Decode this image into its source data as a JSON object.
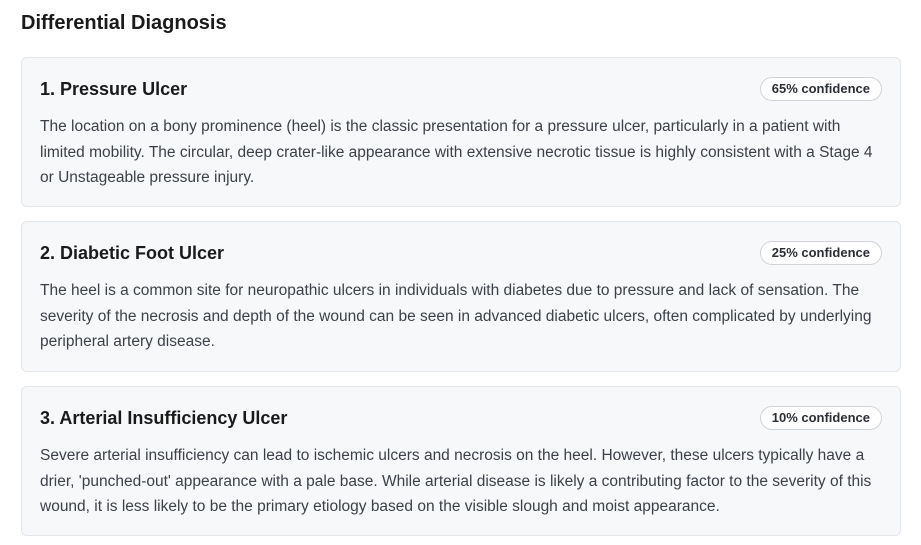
{
  "section": {
    "title": "Differential Diagnosis"
  },
  "diagnoses": [
    {
      "title": "1. Pressure Ulcer",
      "confidence": "65% confidence",
      "description": "The location on a bony prominence (heel) is the classic presentation for a pressure ulcer, particularly in a patient with limited mobility. The circular, deep crater-like appearance with extensive necrotic tissue is highly consistent with a Stage 4 or Unstageable pressure injury."
    },
    {
      "title": "2. Diabetic Foot Ulcer",
      "confidence": "25% confidence",
      "description": "The heel is a common site for neuropathic ulcers in individuals with diabetes due to pressure and lack of sensation. The severity of the necrosis and depth of the wound can be seen in advanced diabetic ulcers, often complicated by underlying peripheral artery disease."
    },
    {
      "title": "3. Arterial Insufficiency Ulcer",
      "confidence": "10% confidence",
      "description": "Severe arterial insufficiency can lead to ischemic ulcers and necrosis on the heel. However, these ulcers typically have a drier, 'punched-out' appearance with a pale base. While arterial disease is likely a contributing factor to the severity of this wound, it is less likely to be the primary etiology based on the visible slough and moist appearance."
    }
  ]
}
